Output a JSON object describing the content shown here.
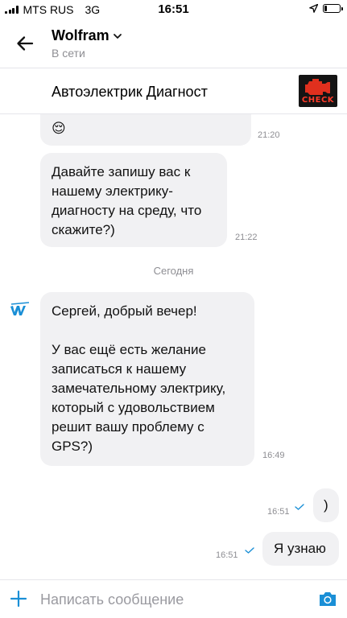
{
  "status_bar": {
    "carrier": "MTS RUS",
    "network": "3G",
    "time": "16:51",
    "battery_level": 0.2,
    "icons": [
      "signal-icon",
      "location-icon",
      "battery-icon"
    ]
  },
  "header": {
    "title": "Wolfram",
    "status": "В сети",
    "icons": [
      "back-arrow-icon",
      "chevron-down-icon"
    ]
  },
  "pinned": {
    "text": "Автоэлектрик Диагност",
    "image_caption": "CHECK"
  },
  "messages": {
    "m1": {
      "text": "Конечно, мы всегда готовы 😌",
      "visible_text": "😌",
      "time": "21:20"
    },
    "m2": {
      "text": "Давайте запишу вас к\nнашему электрику-\nдиагносту на среду, что\nскажите?)",
      "time": "21:22"
    },
    "date_separator": "Сегодня",
    "m3": {
      "text": "Сергей, добрый вечер!\n\nУ вас ещё есть желание\nзаписаться к нашему\nзамечательному электрику,\nкоторый с удовольствием\nрешит вашу проблему с\nGPS?)",
      "time": "16:49"
    },
    "m4": {
      "text": ")",
      "time": "16:51",
      "read": true
    },
    "m5": {
      "text": "Я узнаю",
      "time": "16:51",
      "read": true
    }
  },
  "composer": {
    "placeholder": "Написать сообщение",
    "icons": [
      "plus-icon",
      "camera-icon"
    ]
  },
  "colors": {
    "accent": "#1a8fd6",
    "bubble": "#f1f1f3",
    "secondary_text": "#8e8e93",
    "check_red": "#e0301e"
  }
}
